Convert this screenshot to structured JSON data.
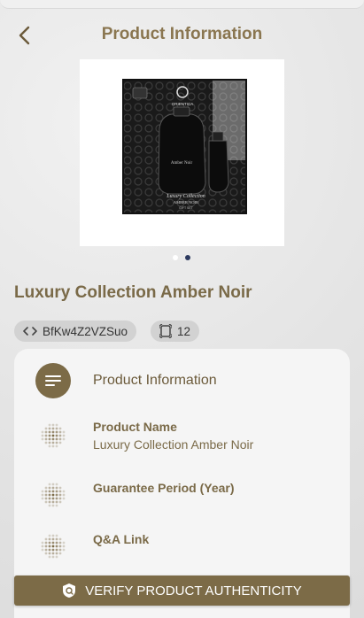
{
  "header": {
    "title": "Product Information"
  },
  "product": {
    "image_alt": "Luxury Collection Amber Noir gift set box",
    "title": "Luxury Collection Amber Noir",
    "code": "BfKw4Z2VZSuo",
    "scan_count": "12",
    "box_brand": "ORIENTICA",
    "box_line": "Luxury Collection",
    "box_name": "AMBER NOIR",
    "box_sub": "GIFT SET",
    "bottle_label": "Amber Noir"
  },
  "carousel": {
    "dots": 2,
    "active": 1
  },
  "panel": {
    "heading": "Product Information",
    "fields": [
      {
        "label": "Product Name",
        "value": "Luxury Collection Amber Noir"
      },
      {
        "label": "Guarantee Period (Year)",
        "value": ""
      },
      {
        "label": "Q&A Link",
        "value": ""
      }
    ]
  },
  "actions": {
    "verify_label": "VERIFY PRODUCT AUTHENTICITY"
  },
  "colors": {
    "accent": "#7c6b47",
    "title": "#8a7650",
    "dot_active": "#2c3a5f"
  }
}
